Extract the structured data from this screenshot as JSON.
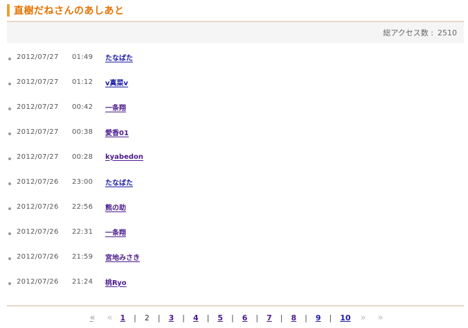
{
  "title": "直樹だねさんのあしあと",
  "access": {
    "label": "総アクセス数 :",
    "count": "2510"
  },
  "rows": [
    {
      "date": "2012/07/27",
      "time": "01:49",
      "name": "たなばた"
    },
    {
      "date": "2012/07/27",
      "time": "01:12",
      "name": "v真菜v"
    },
    {
      "date": "2012/07/27",
      "time": "00:42",
      "name": "一条翔"
    },
    {
      "date": "2012/07/27",
      "time": "00:38",
      "name": "愛香01"
    },
    {
      "date": "2012/07/27",
      "time": "00:28",
      "name": "kyabedon"
    },
    {
      "date": "2012/07/26",
      "time": "23:00",
      "name": "たなばた"
    },
    {
      "date": "2012/07/26",
      "time": "22:56",
      "name": "熊の助"
    },
    {
      "date": "2012/07/26",
      "time": "22:31",
      "name": "一条翔"
    },
    {
      "date": "2012/07/26",
      "time": "21:59",
      "name": "宮地みさき"
    },
    {
      "date": "2012/07/26",
      "time": "21:24",
      "name": "桃Ryo"
    }
  ],
  "pager": {
    "first": "«",
    "prev": "«",
    "next": "»",
    "last": "»",
    "sep": "|",
    "current": "2",
    "pages": [
      "1",
      "3",
      "4",
      "5",
      "6",
      "7",
      "8",
      "9",
      "10"
    ]
  },
  "colors": {
    "accent": "#f0a030",
    "title": "#e67300",
    "link": "#1a1aa6",
    "visited": "#4b1a8b"
  }
}
